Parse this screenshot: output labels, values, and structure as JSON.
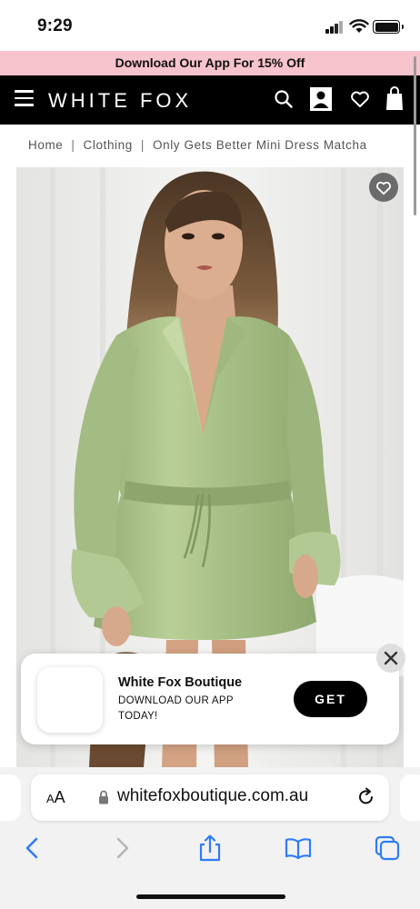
{
  "status_bar": {
    "time": "9:29"
  },
  "promo": {
    "text": "Download Our App For 15% Off"
  },
  "header": {
    "logo": "WHITE FOX"
  },
  "breadcrumb": {
    "items": [
      "Home",
      "Clothing",
      "Only Gets Better Mini Dress Matcha"
    ]
  },
  "product": {
    "image_desc_icon": "product-photo"
  },
  "app_banner": {
    "name": "White Fox Boutique",
    "description": "DOWNLOAD OUR APP TODAY!",
    "get_label": "GET"
  },
  "browser": {
    "aa_label_big": "A",
    "aa_label_small": "A",
    "url": "whitefoxboutique.com.au"
  },
  "colors": {
    "promo_bg": "#f7c3cc",
    "header_bg": "#000000",
    "dress_green": "#a8c088",
    "ios_blue": "#2f7cf6"
  }
}
